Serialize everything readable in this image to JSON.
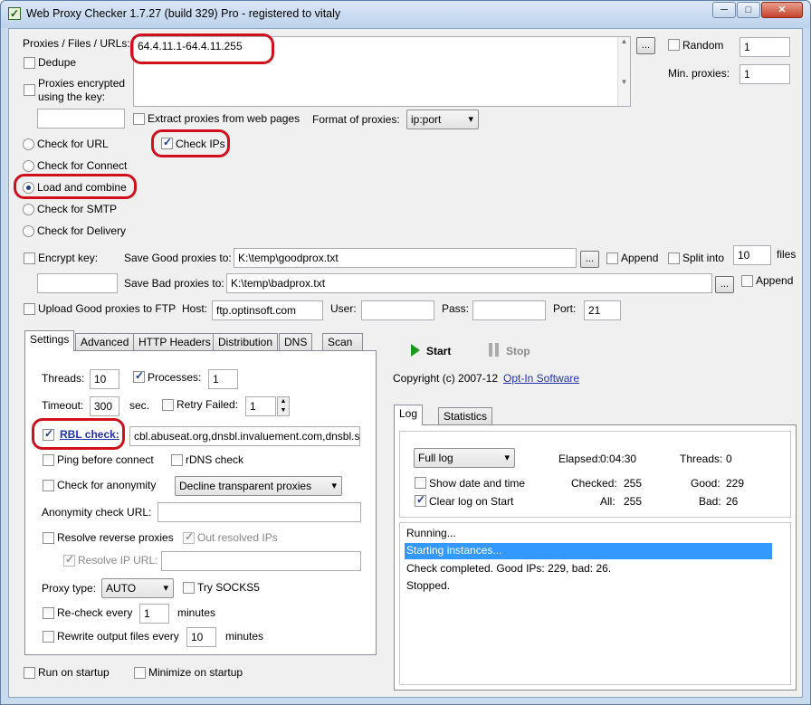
{
  "window": {
    "title": "Web Proxy Checker 1.7.27 (build 329) Pro - registered to vitaly",
    "icon": "check-icon",
    "minimize": "─",
    "maximize": "□",
    "close": "✕"
  },
  "proxies": {
    "label": "Proxies / Files / URLs:",
    "value": "64.4.11.1-64.4.11.255",
    "browse_label": "...",
    "dedupe_label": "Dedupe",
    "encrypted_label": "Proxies encrypted using the key:",
    "key_value": "",
    "random_label": "Random",
    "random_value": "1",
    "min_proxies_label": "Min. proxies:",
    "min_proxies_value": "1",
    "extract_label": "Extract proxies from web pages",
    "format_label": "Format of proxies:",
    "format_value": "ip:port"
  },
  "modes": {
    "url": "Check for URL",
    "check_ips": "Check IPs",
    "connect": "Check for Connect",
    "load_combine": "Load and combine",
    "smtp": "Check for SMTP",
    "delivery": "Check for Delivery",
    "selected": "load_combine"
  },
  "output": {
    "encrypt_key_label": "Encrypt key:",
    "encrypt_key_value": "",
    "save_good_label": "Save Good proxies to:",
    "save_good_value": "K:\\temp\\goodprox.txt",
    "append_label": "Append",
    "split_label": "Split into",
    "split_value": "10",
    "files_label": "files",
    "save_bad_label": "Save Bad proxies to:",
    "save_bad_value": "K:\\temp\\badprox.txt",
    "append_bad_label": "Append",
    "upload_label": "Upload Good proxies to FTP",
    "host_label": "Host:",
    "host_value": "ftp.optinsoft.com",
    "user_label": "User:",
    "user_value": "",
    "pass_label": "Pass:",
    "pass_value": "",
    "port_label": "Port:",
    "port_value": "21",
    "browse_label": "..."
  },
  "tabs": [
    "Settings",
    "Advanced",
    "HTTP Headers",
    "Distribution",
    "DNS",
    "Scan"
  ],
  "settings": {
    "threads_label": "Threads:",
    "threads_value": "10",
    "processes_label": "Processes:",
    "processes_value": "1",
    "timeout_label": "Timeout:",
    "timeout_value": "300",
    "sec_label": "sec.",
    "retry_label": "Retry Failed:",
    "retry_value": "1",
    "rbl_label": "RBL check:",
    "rbl_value": "cbl.abuseat.org,dnsbl.invaluement.com,dnsbl.so",
    "ping_label": "Ping before connect",
    "rdns_label": "rDNS check",
    "anonymity_label": "Check for anonymity",
    "anonymity_select": "Decline transparent proxies",
    "anon_url_label": "Anonymity check URL:",
    "anon_url_value": "",
    "resolve_reverse_label": "Resolve reverse proxies",
    "out_resolved_label": "Out resolved IPs",
    "resolve_ip_url_label": "Resolve IP URL:",
    "resolve_ip_url_value": "",
    "proxy_type_label": "Proxy type:",
    "proxy_type_value": "AUTO",
    "socks5_label": "Try SOCKS5",
    "recheck_label": "Re-check every",
    "recheck_value": "1",
    "recheck_unit": "minutes",
    "rewrite_label": "Rewrite output files every",
    "rewrite_value": "10",
    "rewrite_unit": "minutes"
  },
  "controls": {
    "start_label": "Start",
    "stop_label": "Stop",
    "copyright": "Copyright (c) 2007-12",
    "company_link": "Opt-In Software"
  },
  "log": {
    "tabs": [
      "Log",
      "Statistics"
    ],
    "level_value": "Full log",
    "elapsed_label": "Elapsed:",
    "elapsed_value": "0:04:30",
    "threads_label": "Threads:",
    "threads_value": "0",
    "show_date_label": "Show date and time",
    "checked_label": "Checked:",
    "checked_value": "255",
    "good_label": "Good:",
    "good_value": "229",
    "clear_label": "Clear log on Start",
    "all_label": "All:",
    "all_value": "255",
    "bad_label": "Bad:",
    "bad_value": "26",
    "lines": [
      "Running...",
      "Starting instances...",
      "Check completed. Good IPs: 229, bad: 26.",
      "Stopped."
    ],
    "selected_line": 1
  },
  "footer": {
    "run_startup_label": "Run on startup",
    "minimize_startup_label": "Minimize on startup"
  },
  "colors": {
    "highlight": "#d0101c",
    "selection": "#3399ff",
    "start_green": "#1a9a1a"
  }
}
